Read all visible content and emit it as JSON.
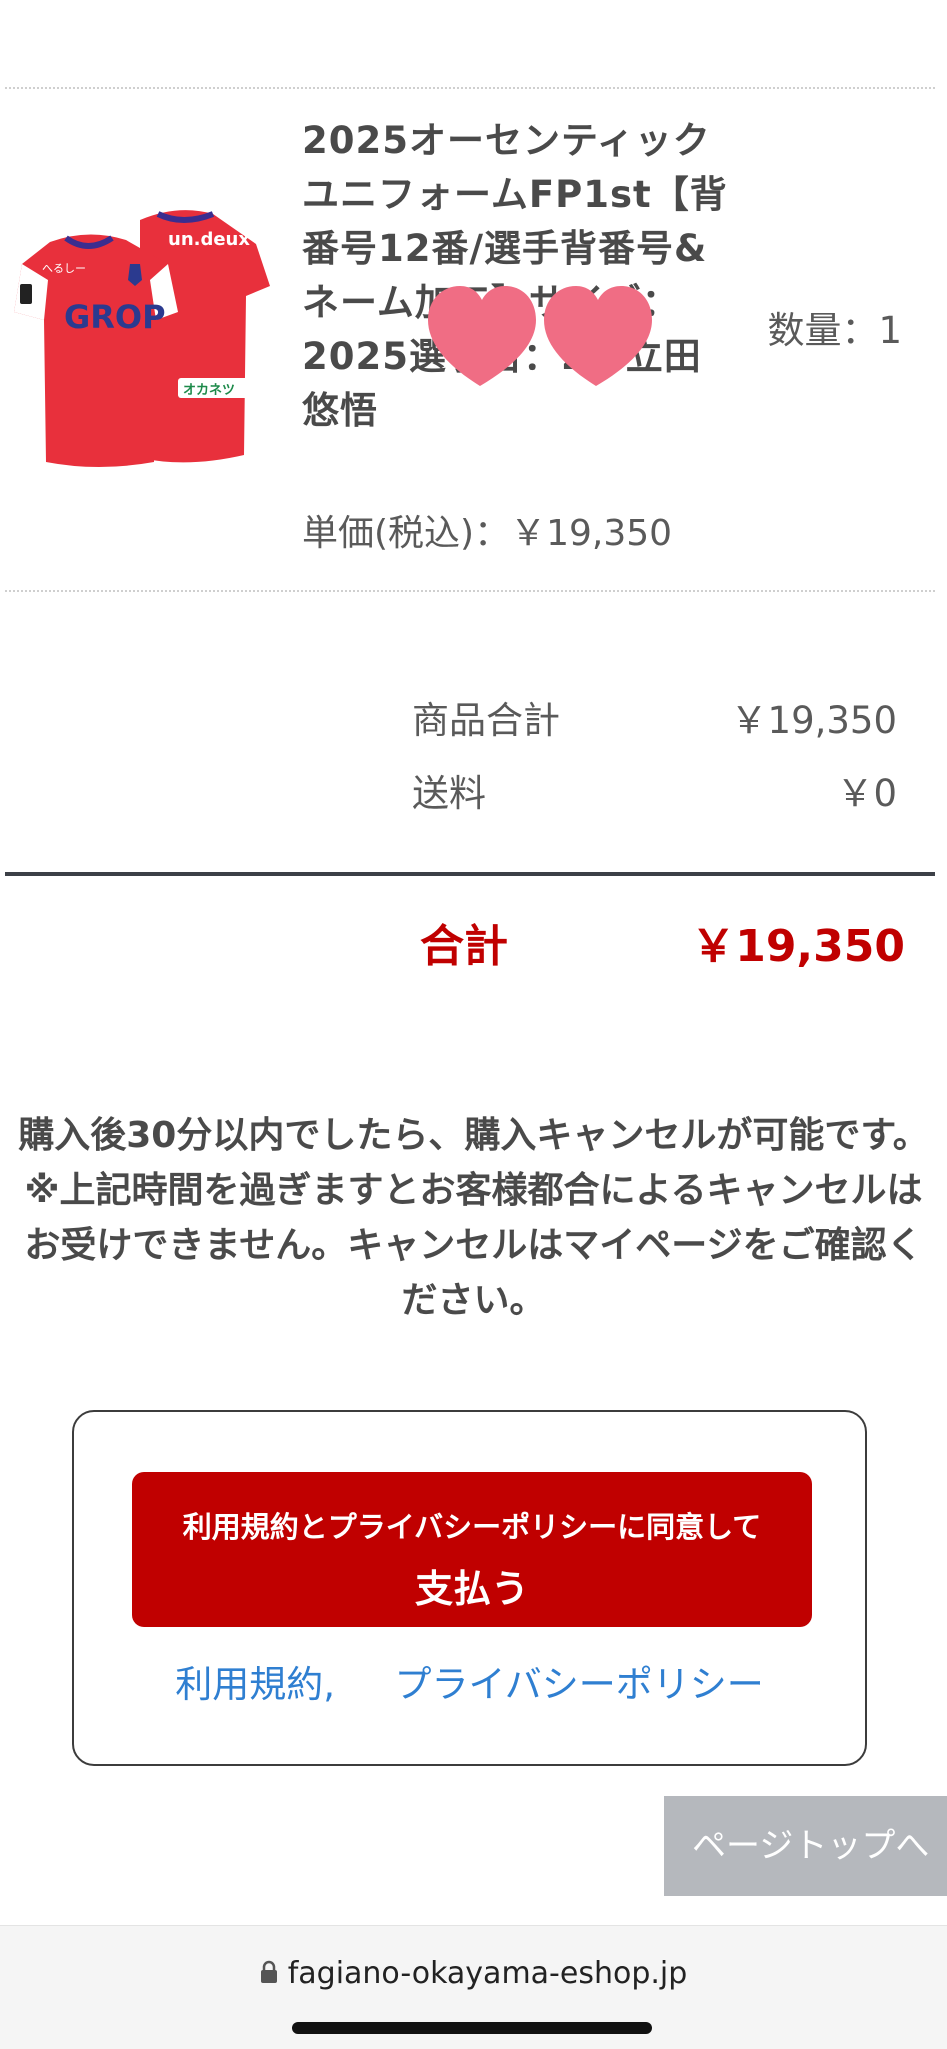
{
  "product": {
    "title": "2025オーセンティックユニフォームFP1st【背番号12番/選手背番号&ネーム加工】サイズ：2025選手名：2：立田　悠悟",
    "unit_price": "単価(税込)：￥19,350",
    "quantity": "数量：1",
    "jersey_front_text": "GROP",
    "jersey_back_text": "un.deux",
    "jersey_sponsor_text": "オカネツ"
  },
  "summary": {
    "subtotal_label": "商品合計",
    "subtotal_value": "￥19,350",
    "shipping_label": "送料",
    "shipping_value": "￥0",
    "total_label": "合計",
    "total_value": "￥19,350"
  },
  "notice": {
    "line1": "購入後30分以内でしたら、購入キャンセルが可能です。",
    "line2": "※上記時間を過ぎますとお客様都合によるキャンセルはお受けできません。キャンセルはマイページをご確認ください。"
  },
  "payment": {
    "button_line1": "利用規約とプライバシーポリシーに同意して",
    "button_line2": "支払う",
    "terms_link": "利用規約,",
    "privacy_link": "プライバシーポリシー"
  },
  "page_top_button": "ページトップへ",
  "browser": {
    "url": "fagiano-okayama-eshop.jp"
  },
  "colors": {
    "accent_red": "#c00000",
    "link_blue": "#2f7fd1",
    "heart_pink": "#f06d84"
  }
}
